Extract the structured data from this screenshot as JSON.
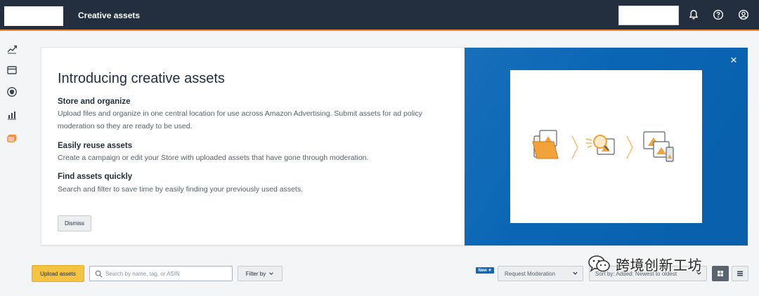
{
  "header": {
    "title": "Creative assets"
  },
  "intro": {
    "title": "Introducing creative assets",
    "sections": [
      {
        "heading": "Store and organize",
        "body": "Upload files and organize in one central location for use across Amazon Advertising. Submit assets for ad policy moderation so they are ready to be used."
      },
      {
        "heading": "Easily reuse assets",
        "body": "Create a campaign or edit your Store with uploaded assets that have gone through moderation."
      },
      {
        "heading": "Find assets quickly",
        "body": "Search and filter to save time by easily finding your previously used assets."
      }
    ],
    "dismiss_label": "Dismiss",
    "close_symbol": "×"
  },
  "toolbar": {
    "upload_label": "Upload assets",
    "search_placeholder": "Search by name, tag, or ASIN",
    "filter_label": "Filter by",
    "new_badge": "New ✦",
    "moderation_label": "Request Moderation",
    "sort_label": "Sort by: Added: Newest to oldest"
  },
  "watermark": {
    "text": "跨境创新工坊"
  },
  "colors": {
    "header_bg": "#232f3e",
    "header_accent": "#e8802c",
    "promo_blue": "#0a66b5",
    "upload_yellow": "#f5c242",
    "illustration_orange": "#f2a23a"
  },
  "icons": {
    "header": [
      "bell-icon",
      "help-icon",
      "account-icon"
    ],
    "rail": [
      "campaigns-icon",
      "stores-icon",
      "shield-icon",
      "reports-icon",
      "creative-assets-icon"
    ],
    "toolbar": [
      "search-icon",
      "chevron-down-icon",
      "grid-view-icon",
      "list-view-icon"
    ]
  }
}
